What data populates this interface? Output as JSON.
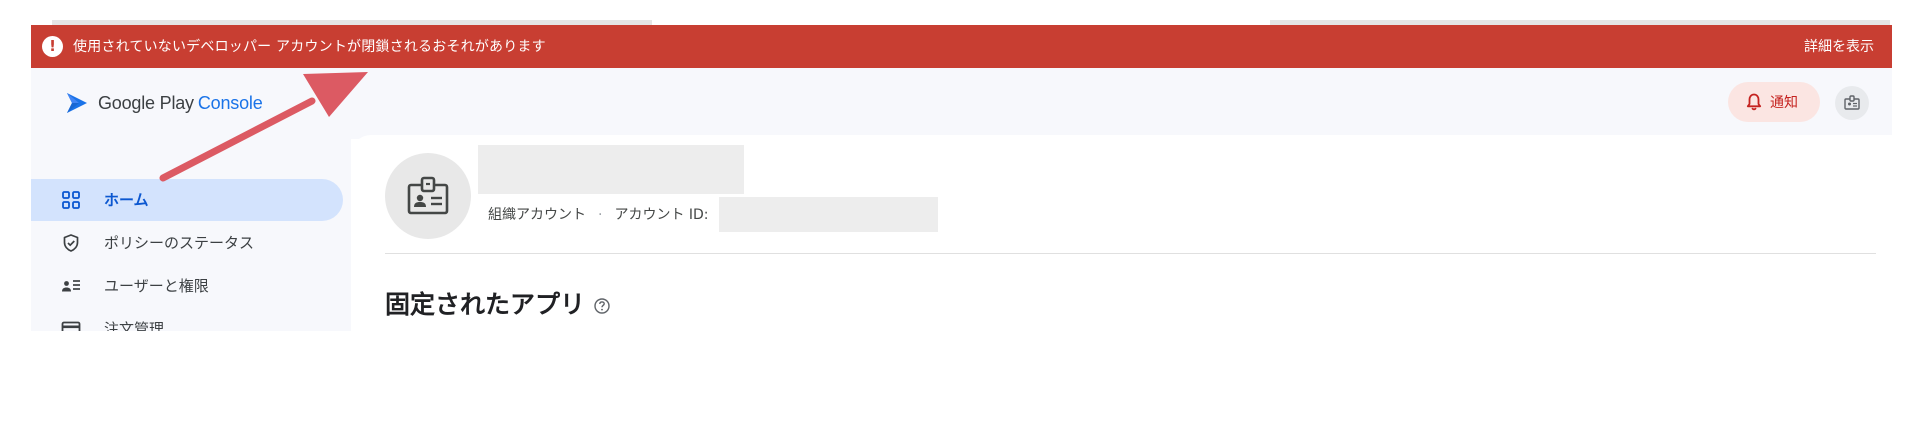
{
  "banner": {
    "icon": "exclamation-icon",
    "message": "使用されていないデベロッパー アカウントが閉鎖されるおそれがあります",
    "details_link": "詳細を表示",
    "color": "#c83e32"
  },
  "header": {
    "logo_main": "Google Play",
    "logo_accent": "Console",
    "notifications_label": "通知"
  },
  "sidebar": {
    "items": [
      {
        "label": "ホーム",
        "icon": "dashboard-icon",
        "active": true
      },
      {
        "label": "ポリシーのステータス",
        "icon": "shield-check-icon",
        "active": false
      },
      {
        "label": "ユーザーと権限",
        "icon": "user-list-icon",
        "active": false
      },
      {
        "label": "注文管理",
        "icon": "credit-card-icon",
        "active": false
      }
    ]
  },
  "main": {
    "account_type": "組織アカウント",
    "separator": "·",
    "account_id_label": "アカウント ID:",
    "pinned_apps_title": "固定されたアプリ"
  },
  "colors": {
    "accent": "#1a73e8",
    "active_nav_bg": "#d3e3fd",
    "annotation_arrow": "#dc5a63"
  }
}
